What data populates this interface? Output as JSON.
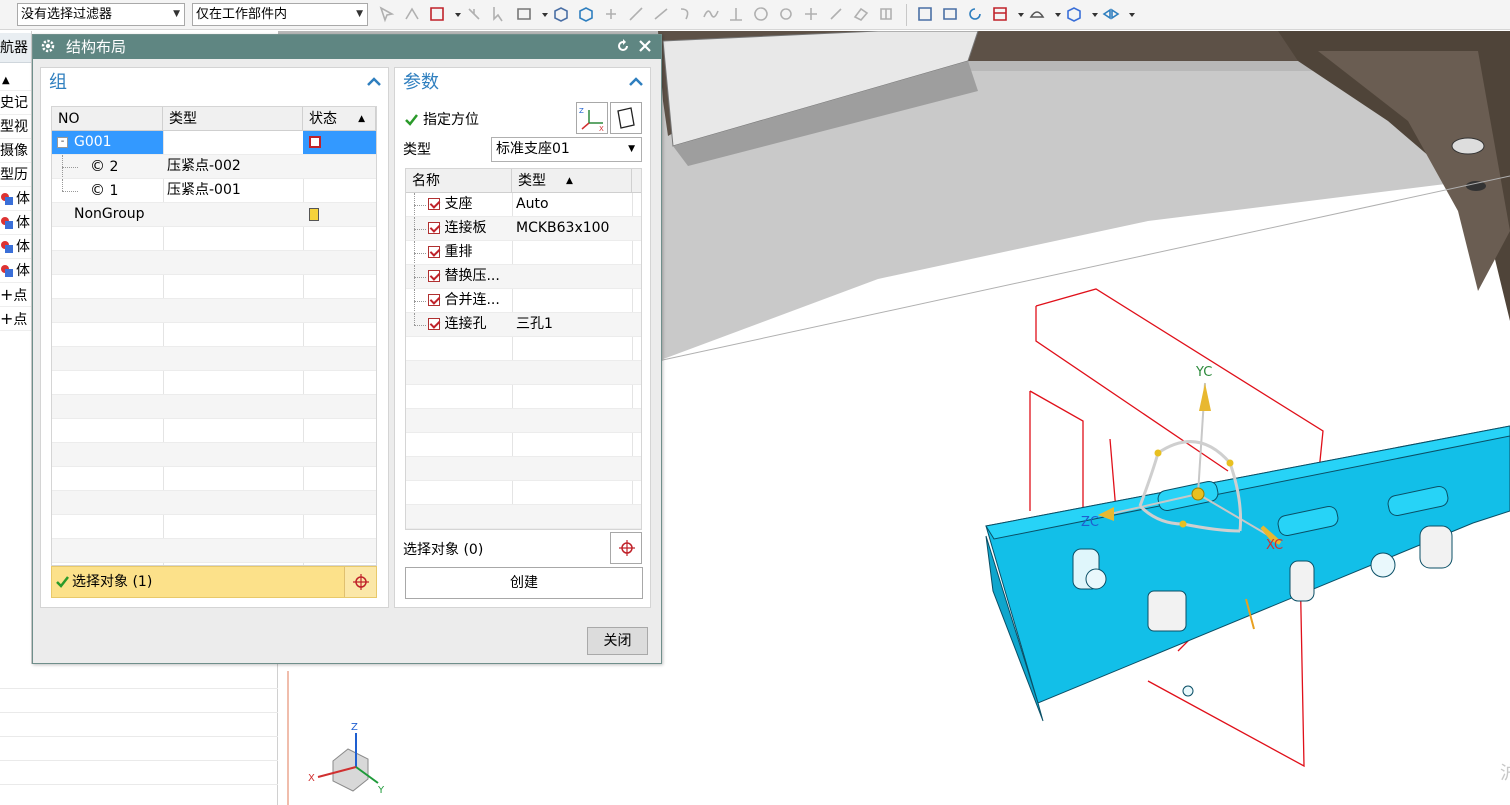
{
  "toolbar": {
    "filter_combo": "没有选择过滤器",
    "scope_combo": "仅在工作部件内"
  },
  "navigator": {
    "tab_label": "航器",
    "items": [
      "史记",
      "型视",
      "摄像",
      "型历",
      "体",
      "体",
      "体",
      "体",
      "点",
      "点"
    ]
  },
  "dialog": {
    "title": "结构布局",
    "group_panel": {
      "title": "组",
      "columns": [
        "NO",
        "类型",
        "状态"
      ],
      "rows": [
        {
          "no": "G001",
          "type": "",
          "indent": 0,
          "expander": "-"
        },
        {
          "no": "2",
          "type": "压紧点-002",
          "indent": 1
        },
        {
          "no": "1",
          "type": "压紧点-001",
          "indent": 1
        },
        {
          "no": "NonGroup",
          "type": "",
          "indent": 0
        }
      ],
      "select_label": "选择对象 (1)"
    },
    "params_panel": {
      "title": "参数",
      "orient_label": "指定方位",
      "type_label": "类型",
      "type_value": "标准支座01",
      "columns": [
        "名称",
        "类型"
      ],
      "rows": [
        {
          "name": "支座",
          "type": "Auto"
        },
        {
          "name": "连接板",
          "type": "MCKB63x100"
        },
        {
          "name": "重排",
          "type": ""
        },
        {
          "name": "替换压...",
          "type": ""
        },
        {
          "name": "合并连...",
          "type": ""
        },
        {
          "name": "连接孔",
          "type": "三孔1"
        }
      ],
      "select_label": "选择对象 (0)",
      "create_label": "创建"
    },
    "close_label": "关闭"
  },
  "viewport": {
    "axis_labels": {
      "yc": "YC",
      "zc": "ZC",
      "xc": "XC"
    },
    "triad_labels": {
      "z": "Z",
      "x": "X",
      "y": "Y"
    },
    "watermark": "沪"
  },
  "colors": {
    "dialog_title_bar": "#5f8682",
    "accent_blue": "#3399ff",
    "select_highlight": "#fce18a",
    "part_cyan": "#14c3ea",
    "frame_red": "#e0101a"
  }
}
